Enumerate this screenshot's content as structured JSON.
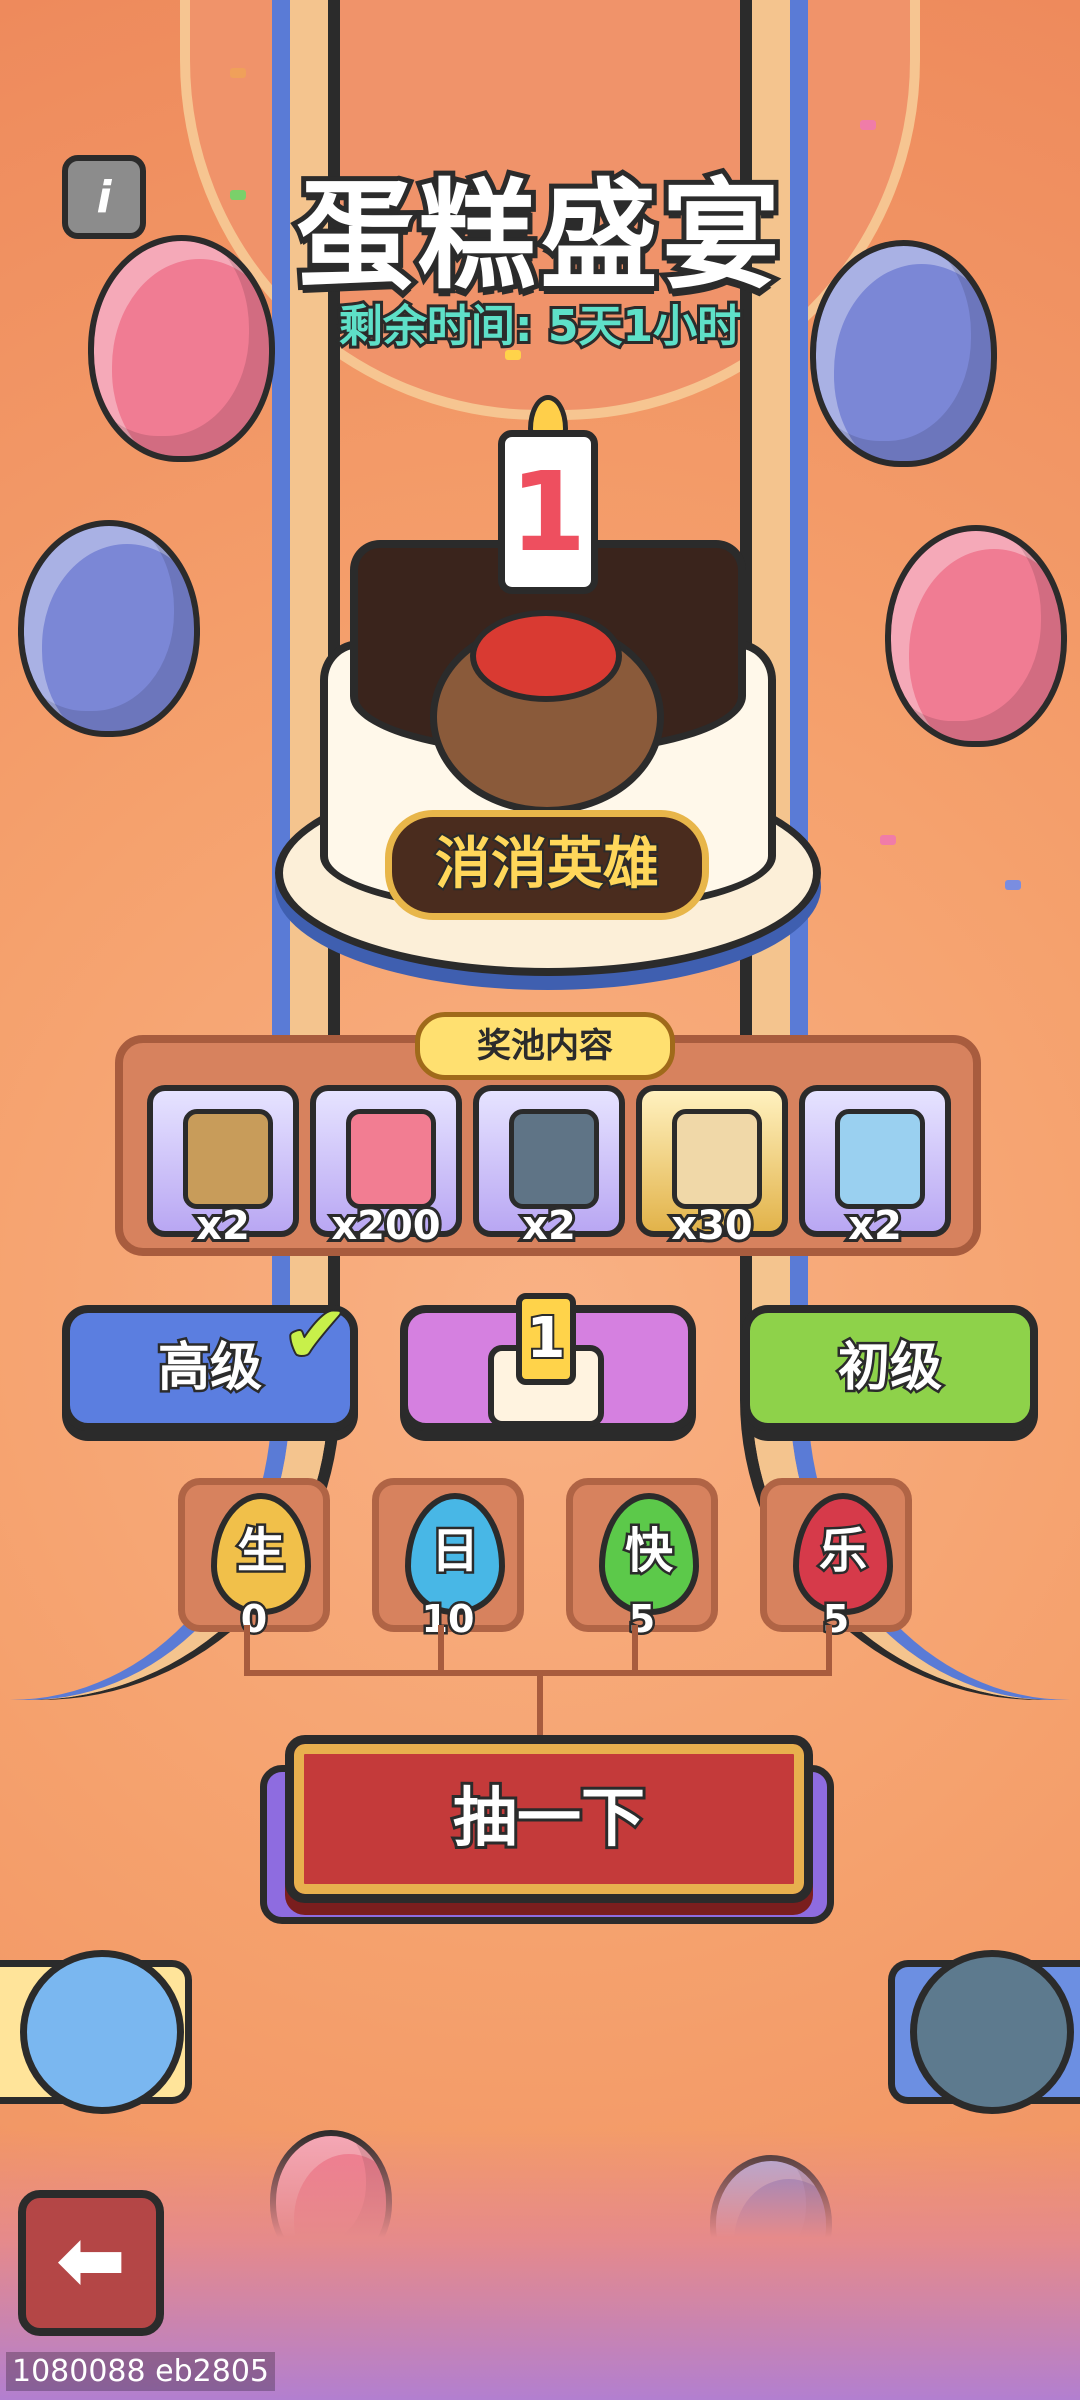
{
  "event": {
    "title": "蛋糕盛宴",
    "timer": "剩余时间: 5天1小时",
    "cake_badge": "消消英雄",
    "candle_number": "1"
  },
  "prize_pool": {
    "label": "奖池内容",
    "items": [
      {
        "name": "helmet-book",
        "count": "x2"
      },
      {
        "name": "diamond",
        "count": "x200"
      },
      {
        "name": "dark-helmet-book",
        "count": "x2"
      },
      {
        "name": "shirt",
        "count": "x30"
      },
      {
        "name": "key-card",
        "count": "x2"
      }
    ]
  },
  "tiers": {
    "advanced": "高级",
    "basic": "初级",
    "middle_candle": "1"
  },
  "eggs": [
    {
      "char": "生",
      "count": "0",
      "color": "#f1c04a"
    },
    {
      "char": "日",
      "count": "10",
      "color": "#48b7e6"
    },
    {
      "char": "快",
      "count": "5",
      "color": "#5cc94a"
    },
    {
      "char": "乐",
      "count": "5",
      "color": "#d63a4a"
    }
  ],
  "actions": {
    "draw": "抽一下",
    "info_icon": "i",
    "back_icon": "⬅"
  },
  "watermark": "1080088 eb2805"
}
